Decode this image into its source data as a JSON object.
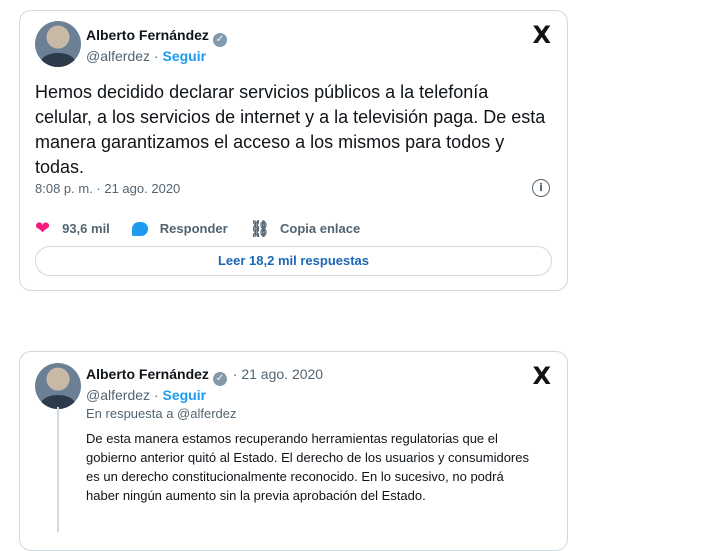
{
  "tweet1": {
    "author": "Alberto Fernández",
    "handle": "@alferdez",
    "separator": "·",
    "follow": "Seguir",
    "text": "Hemos decidido declarar servicios públicos a la telefonía celular, a los servicios de internet y a la televisión paga. De esta manera garantizamos el acceso a los mismos para todos y todas.",
    "timestamp": "8:08 p. m. · 21 ago. 2020",
    "likes": "93,6 mil",
    "reply": "Responder",
    "copy_link": "Copia enlace",
    "read_replies": "Leer 18,2 mil respuestas"
  },
  "tweet2": {
    "author": "Alberto Fernández",
    "date": "· 21 ago. 2020",
    "handle": "@alferdez",
    "separator": "·",
    "follow": "Seguir",
    "reply_to": "En respuesta a @alferdez",
    "text": "De esta manera estamos recuperando herramientas regulatorias que el gobierno anterior quitó al Estado. El derecho de los usuarios y consumidores es un derecho constitucionalmente reconocido. En lo sucesivo, no podrá haber ningún aumento sin la previa aprobación del Estado."
  },
  "icons": {
    "x_logo": "𝕏",
    "verified": "✓",
    "info": "i",
    "heart": "❤",
    "link": "🔗"
  },
  "colors": {
    "accent": "#1d9bf0",
    "like": "#f91880",
    "border": "#cfd9de",
    "muted": "#536471"
  }
}
